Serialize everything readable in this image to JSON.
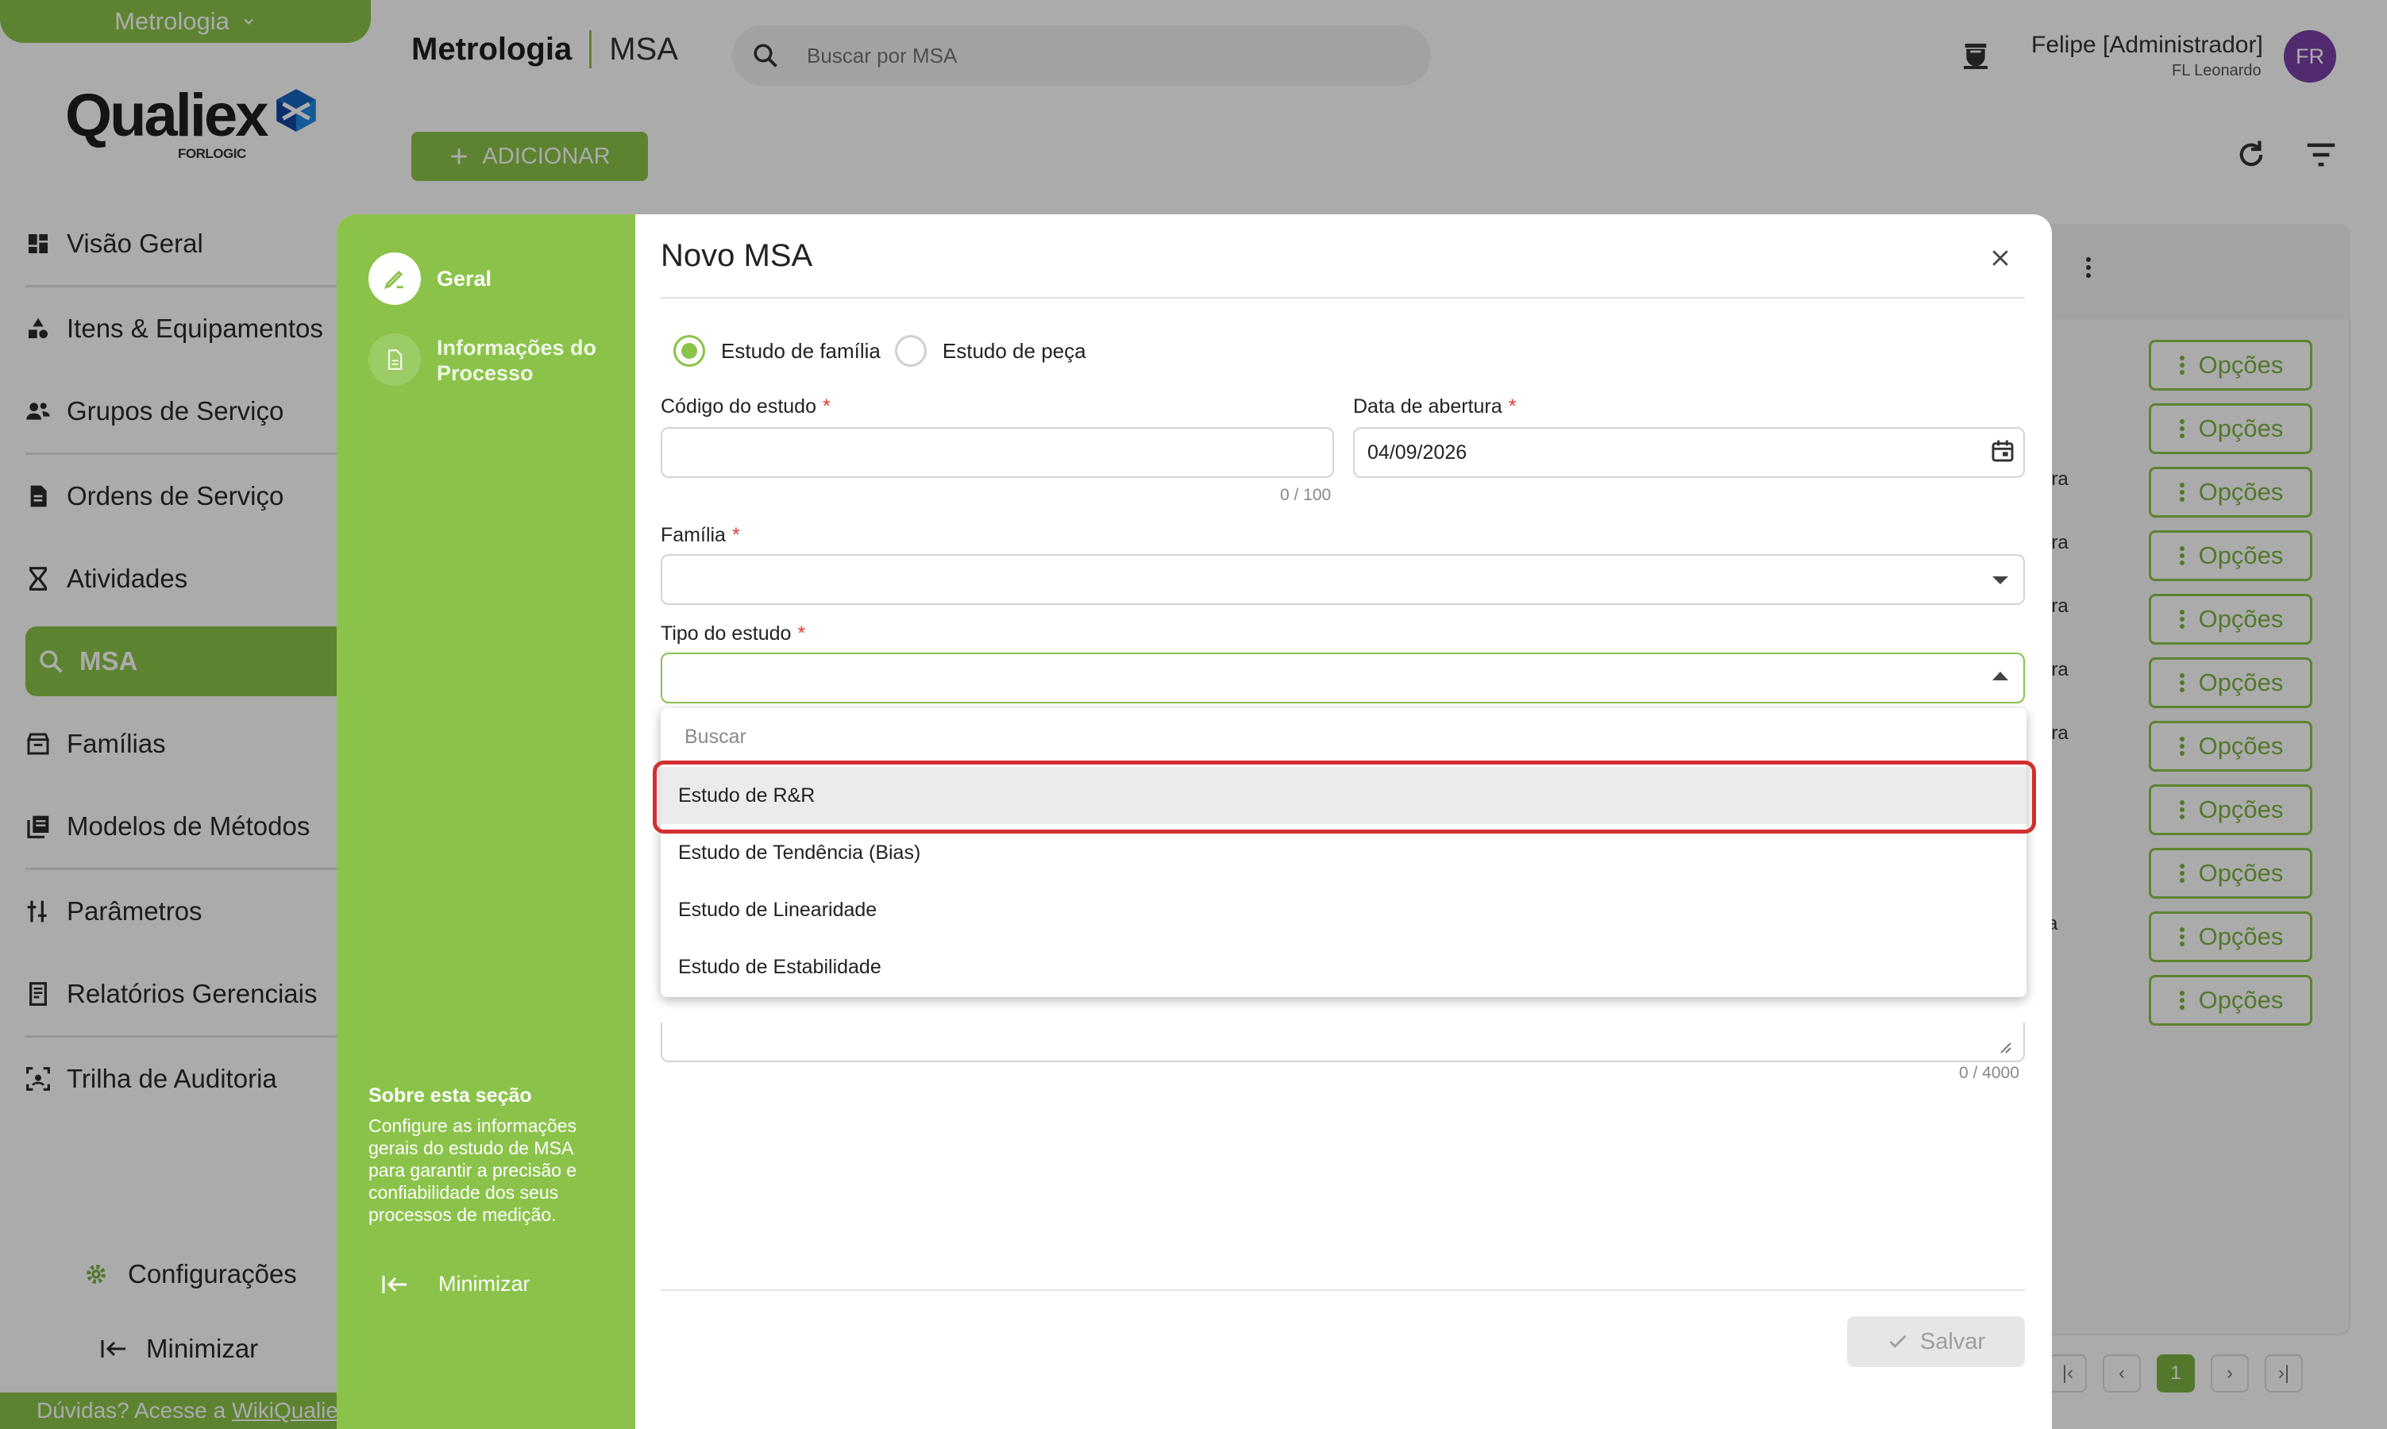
{
  "sidebar": {
    "module": "Metrologia",
    "logo": {
      "word": "Qualiex",
      "sub": "FORLOGIC"
    },
    "items": [
      {
        "label": "Visão Geral"
      },
      {
        "label": "Itens & Equipamentos"
      },
      {
        "label": "Grupos de Serviço"
      },
      {
        "label": "Ordens de Serviço"
      },
      {
        "label": "Atividades"
      },
      {
        "label": "MSA"
      },
      {
        "label": "Famílias"
      },
      {
        "label": "Modelos de Métodos"
      },
      {
        "label": "Parâmetros"
      },
      {
        "label": "Relatórios Gerenciais"
      },
      {
        "label": "Trilha de Auditoria"
      }
    ],
    "settings_label": "Configurações",
    "minimize_label": "Minimizar",
    "help_text": "Dúvidas? Acesse a",
    "help_link": "WikiQualiex"
  },
  "topbar": {
    "title": "Metrologia",
    "subtitle": "MSA",
    "search_placeholder": "Buscar por MSA",
    "user_name": "Felipe [Administrador]",
    "user_org": "FL Leonardo",
    "avatar_initials": "FR"
  },
  "toolbar": {
    "add_label": "ADICIONAR"
  },
  "table": {
    "option_label": "Opções",
    "row_fragments": [
      "ira",
      "ira",
      "ira",
      "ira",
      "ira",
      "a"
    ],
    "current_page": "1"
  },
  "modal": {
    "title": "Novo MSA",
    "steps": [
      {
        "label": "Geral"
      },
      {
        "label": "Informações do\nProcesso"
      }
    ],
    "about_title": "Sobre esta seção",
    "about_text": "Configure as informações gerais do estudo de MSA para garantir a precisão e confiabilidade dos seus processos de medição.",
    "minimize_label": "Minimizar",
    "radio": {
      "family": "Estudo de família",
      "piece": "Estudo de peça"
    },
    "fields": {
      "code_label": "Código do estudo",
      "code_counter": "0 / 100",
      "date_label": "Data de abertura",
      "date_value": "04/09/2026",
      "family_label": "Família",
      "type_label": "Tipo do estudo",
      "desc_counter": "0 / 4000"
    },
    "dropdown": {
      "search_placeholder": "Buscar",
      "options": [
        {
          "label": "Estudo de R&R"
        },
        {
          "label": "Estudo de Tendência (Bias)"
        },
        {
          "label": "Estudo de Linearidade"
        },
        {
          "label": "Estudo de Estabilidade"
        }
      ]
    },
    "save_label": "Salvar"
  },
  "colors": {
    "accent": "#8bc34a",
    "avatar": "#7b3fa8",
    "highlight": "#d32f2f"
  }
}
